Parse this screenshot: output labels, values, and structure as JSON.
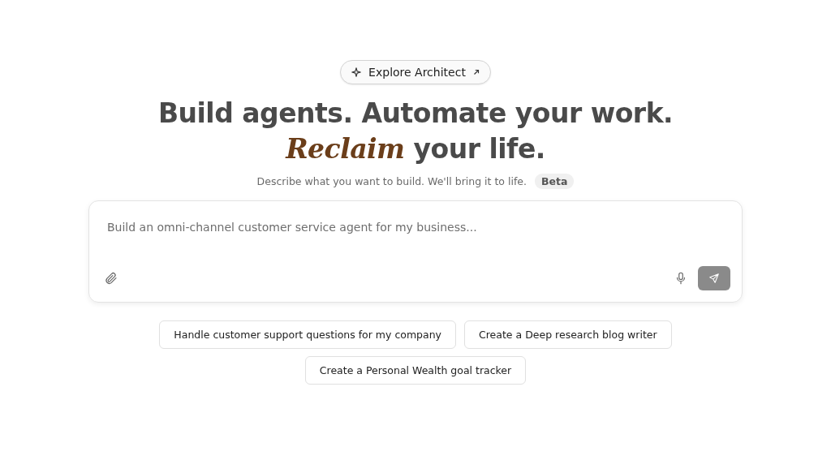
{
  "explore_button": {
    "label": "Explore Architect"
  },
  "headline": {
    "line_1": "Build agents. Automate your work.",
    "line_2": "*Reclaim* your life."
  },
  "subtitle": {
    "text": "Describe what you want to build. We'll bring it to life.",
    "badge": "Beta"
  },
  "prompt": {
    "placeholder": "Build an omni-channel customer service agent for my business...",
    "send_disabled": true
  },
  "suggestions": [
    {
      "label": "Handle customer support questions for my company"
    },
    {
      "label": "Create a Deep research blog writer"
    },
    {
      "label": "Create a Personal Wealth goal tracker"
    }
  ]
}
